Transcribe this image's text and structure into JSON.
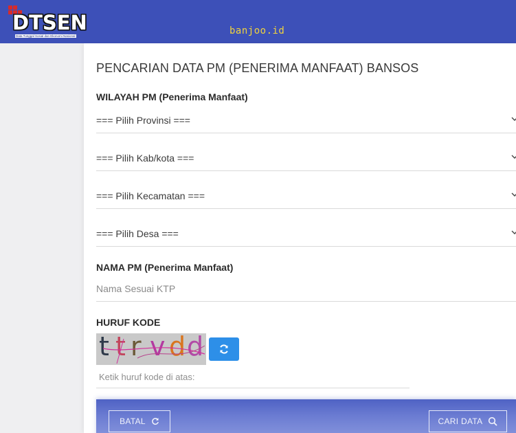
{
  "header": {
    "logo_text": "DTSEN",
    "logo_subtext": "Data Tunggal Sosial dan Ekonomi Nasional",
    "watermark": "banjoo.id"
  },
  "form": {
    "title": "PENCARIAN DATA PM (PENERIMA MANFAAT) BANSOS",
    "region_label": "WILAYAH PM (Penerima Manfaat)",
    "province_select": "=== Pilih Provinsi ===",
    "city_select": "=== Pilih Kab/kota ===",
    "district_select": "=== Pilih Kecamatan ===",
    "village_select": "=== Pilih Desa ===",
    "name_label": "NAMA PM (Penerima Manfaat)",
    "name_placeholder": "Nama Sesuai KTP",
    "code_label": "HURUF KODE",
    "captcha_text": "ttrvdd",
    "code_placeholder": "Ketik huruf kode di atas:"
  },
  "actions": {
    "cancel_label": "BATAL",
    "search_label": "CARI DATA"
  },
  "icons": {
    "refresh": "refresh-icon",
    "search": "search-icon",
    "reset": "reset-icon",
    "chevron": "chevron-down-icon"
  },
  "colors": {
    "header_bg": "#3d50b8",
    "accent_blue": "#2d8fe8",
    "logo_red": "#d62b2b",
    "watermark": "#f1d33c"
  }
}
